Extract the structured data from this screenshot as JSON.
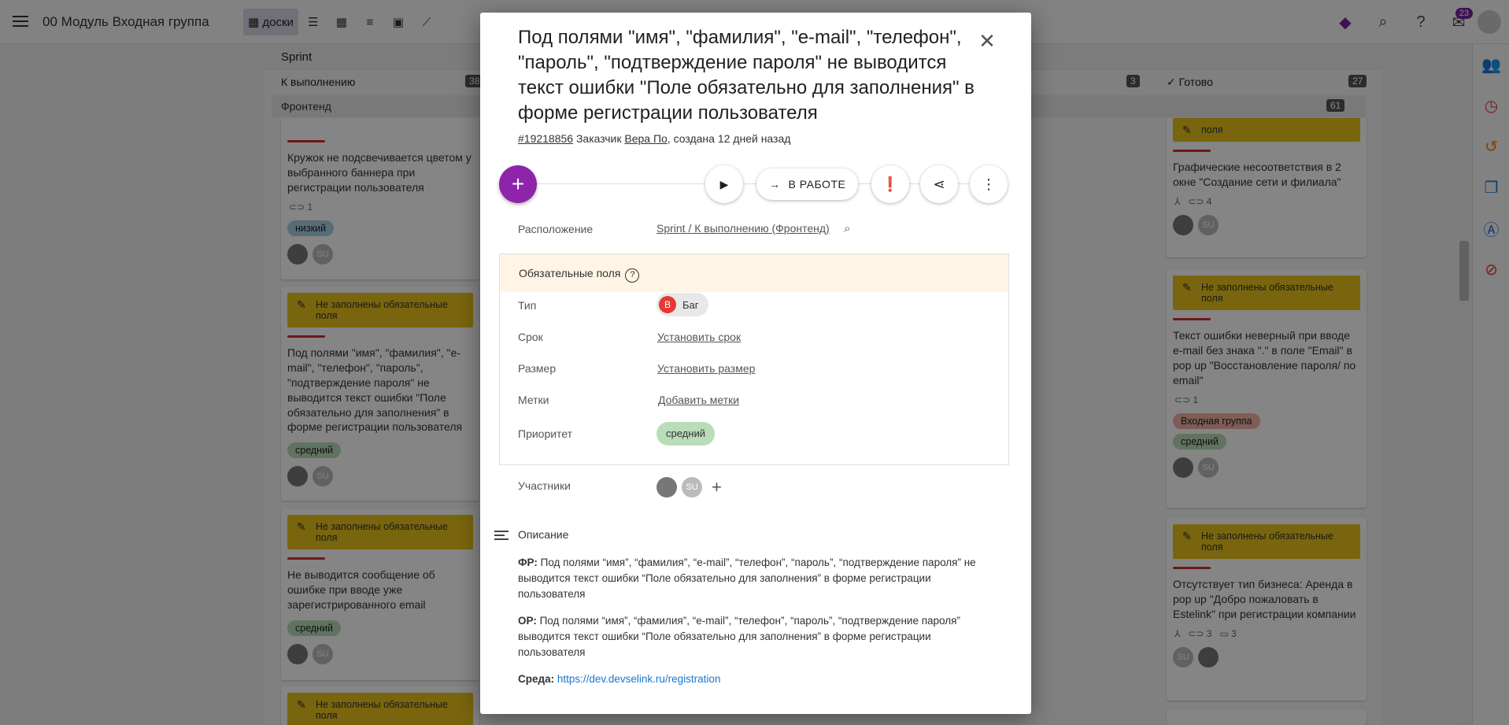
{
  "topbar": {
    "project_name": "00 Модуль Входная группа",
    "boards_label": "доски",
    "notifications_count": "23"
  },
  "board": {
    "lane_title": "Sprint",
    "columns": [
      {
        "label": "К выполнению",
        "count": "38"
      },
      {
        "label": "",
        "count": "3"
      },
      {
        "label": "Готово",
        "count": "27"
      }
    ],
    "swimlane": {
      "label": "Фронтенд",
      "count": "61"
    },
    "left_cards": [
      {
        "text": "Кружок не подсвечивается цветом у выбранного баннера при регистрации пользователя",
        "links": "1",
        "tag": "низкий",
        "banner": ""
      },
      {
        "banner": "Не заполнены обязательные поля",
        "text": "Под полями \"имя\", \"фамилия\", \"e-mail\", \"телефон\", \"пароль\", \"подтверждение пароля\" не выводится текст ошибки \"Поле обязательно для заполнения\" в форме регистрации пользователя",
        "tag": "средний"
      },
      {
        "banner": "Не заполнены обязательные поля",
        "text": "Не выводится сообщение об ошибке при вводе уже зарегистрированного email",
        "tag": "средний"
      },
      {
        "banner": "Не заполнены обязательные поля"
      }
    ],
    "right_cards": [
      {
        "banner": "поля",
        "text": "Графические несоответствия в 2 окне \"Создание сети и филиала\"",
        "links": "4"
      },
      {
        "banner": "Не заполнены обязательные поля",
        "text": "Текст ошибки неверный при вводе e-mail без знака \".\" в поле \"Email\" в pop up \"Восстановление пароля/ по email\"",
        "links": "1",
        "tag1": "Входная группа",
        "tag2": "средний"
      },
      {
        "banner": "Не заполнены обязательные поля",
        "text": "Отсутствует тип бизнеса: Аренда в pop up \"Добро пожаловать в Estelink\" при регистрации компании",
        "links": "3",
        "comments": "3"
      }
    ],
    "avatar_initials": "SU"
  },
  "modal": {
    "title": "Под полями \"имя\", \"фамилия\", \"e-mail\", \"телефон\", \"пароль\", \"подтверждение пароля\" не выводится текст ошибки \"Поле обязательно для заполнения\" в форме регистрации пользователя",
    "issue_id": "#19218856",
    "customer_label": "Заказчик",
    "customer_name": "Вера По",
    "created": ", создана 12 дней назад",
    "status_button": "В РАБОТЕ",
    "location_label": "Расположение",
    "location_value": "Sprint / К выполнению (Фронтенд)",
    "required_header": "Обязательные поля",
    "type_label": "Тип",
    "type_badge": "B",
    "type_value": "Баг",
    "deadline_label": "Срок",
    "deadline_value": "Установить срок",
    "size_label": "Размер",
    "size_value": "Установить размер",
    "tags_label": "Метки",
    "tags_value": "Добавить метки",
    "priority_label": "Приоритет",
    "priority_value": "средний",
    "participants_label": "Участники",
    "participant_initials": "SU",
    "description_title": "Описание",
    "fr_label": "ФР:",
    "fr_text": "Под полями “имя”, “фамилия”, “e-mail”, “телефон”, “пароль”, “подтверждение пароля” не выводится текст ошибки “Поле обязательно для заполнения” в форме регистрации пользователя",
    "or_label": "ОР:",
    "or_text": "Под полями “имя”, “фамилия”, “e-mail”, “телефон”, “пароль”, “подтверждение пароля” выводится текст ошибки “Поле обязательно для заполнения” в форме регистрации пользователя",
    "env_label": "Среда:",
    "env_link": "https://dev.devselink.ru/registration"
  }
}
